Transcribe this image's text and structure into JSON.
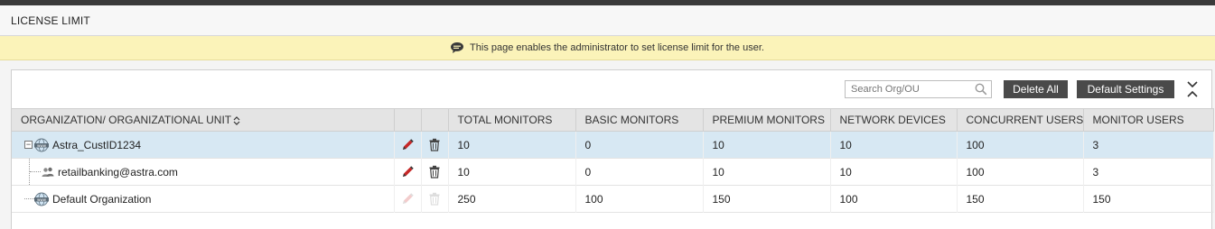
{
  "page": {
    "title": "LICENSE LIMIT",
    "info_message": "This page enables the administrator to set license limit for the user."
  },
  "toolbar": {
    "search_placeholder": "Search Org/OU",
    "delete_all_label": "Delete All",
    "default_settings_label": "Default Settings"
  },
  "table": {
    "columns": [
      "ORGANIZATION/ ORGANIZATIONAL UNIT",
      "TOTAL MONITORS",
      "BASIC MONITORS",
      "PREMIUM MONITORS",
      "NETWORK DEVICES",
      "CONCURRENT USERS",
      "MONITOR USERS"
    ],
    "rows": [
      {
        "name": "Astra_CustID1234",
        "type": "organization",
        "expandable": true,
        "selected": true,
        "actions_enabled": true,
        "total_monitors": "10",
        "basic_monitors": "0",
        "premium_monitors": "10",
        "network_devices": "10",
        "concurrent_users": "100",
        "monitor_users": "3"
      },
      {
        "name": "retailbanking@astra.com",
        "type": "organizational-unit",
        "expandable": false,
        "selected": false,
        "actions_enabled": true,
        "total_monitors": "10",
        "basic_monitors": "0",
        "premium_monitors": "10",
        "network_devices": "10",
        "concurrent_users": "100",
        "monitor_users": "3"
      },
      {
        "name": "Default Organization",
        "type": "organization",
        "expandable": false,
        "selected": false,
        "actions_enabled": false,
        "total_monitors": "250",
        "basic_monitors": "100",
        "premium_monitors": "150",
        "network_devices": "100",
        "concurrent_users": "150",
        "monitor_users": "150"
      }
    ]
  },
  "colors": {
    "info_bar": "#fbf3b9",
    "selected_row": "#d7e8f3",
    "button": "#4a4a4a",
    "edit_icon_active": "#c62828"
  },
  "icons": [
    "info-bubble-icon",
    "search-icon",
    "collapse-icon",
    "sort-icon",
    "globe-icon",
    "users-icon",
    "edit-icon",
    "delete-icon",
    "expand-toggle-icon"
  ]
}
